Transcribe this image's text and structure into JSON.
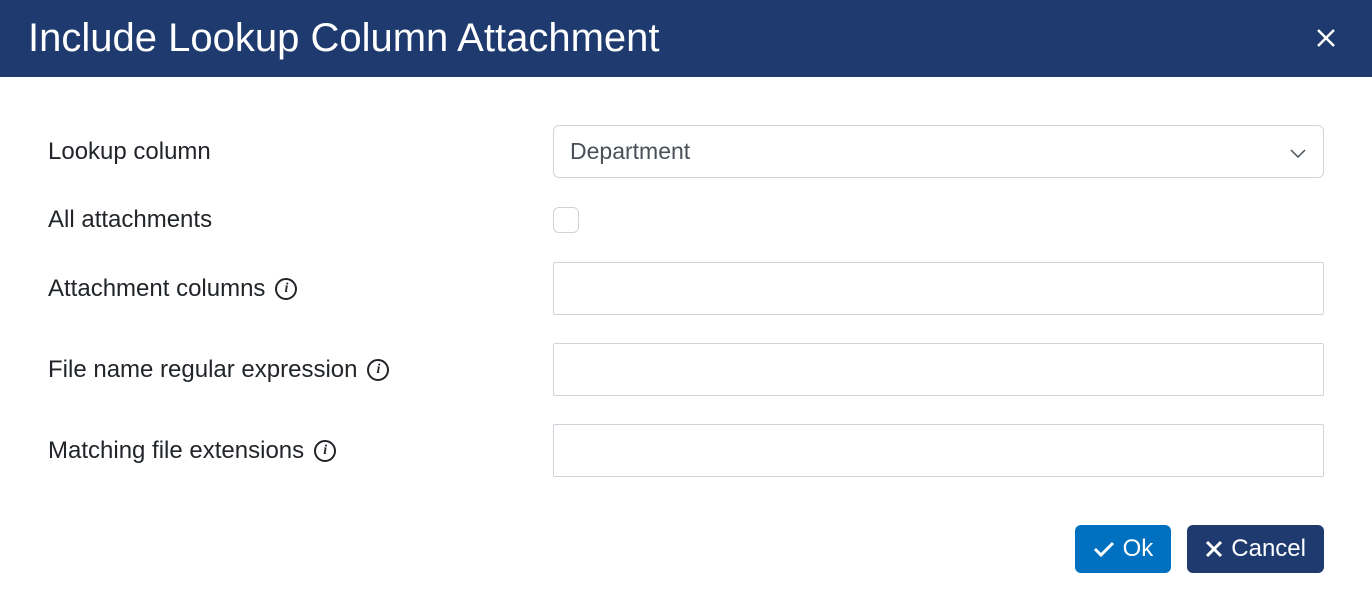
{
  "dialog": {
    "title": "Include Lookup Column Attachment",
    "fields": {
      "lookup_column": {
        "label": "Lookup column",
        "value": "Department"
      },
      "all_attachments": {
        "label": "All attachments",
        "checked": false
      },
      "attachment_columns": {
        "label": "Attachment columns",
        "value": ""
      },
      "file_regex": {
        "label": "File name regular expression",
        "value": ""
      },
      "matching_ext": {
        "label": "Matching file extensions",
        "value": ""
      }
    },
    "buttons": {
      "ok": "Ok",
      "cancel": "Cancel"
    }
  }
}
